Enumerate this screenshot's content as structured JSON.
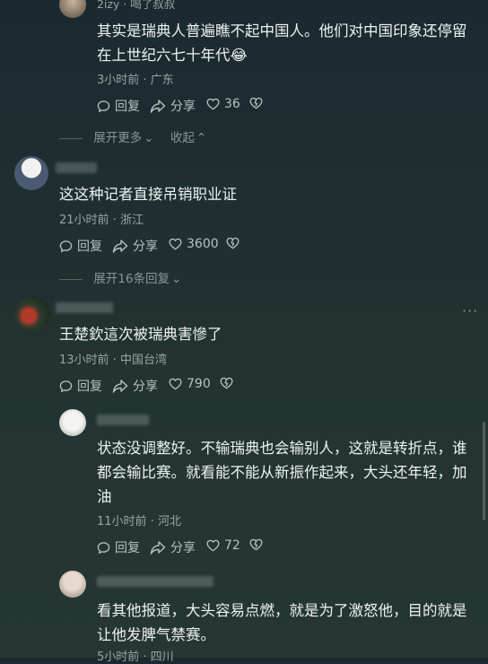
{
  "comments": [
    {
      "username": "2izy · 喝了叔叔",
      "text_lines": [
        "其实是瑞典人普遍瞧不起中国人。他们对中国印象还停留",
        "在上世纪六七十年代😂"
      ],
      "meta": "3小时前 · 广东",
      "reply_label": "回复",
      "share_label": "分享",
      "likes": "36"
    },
    {
      "username": "",
      "text_lines": [
        "这这种记者直接吊销职业证"
      ],
      "meta": "21小时前 · 浙江",
      "reply_label": "回复",
      "share_label": "分享",
      "likes": "3600"
    },
    {
      "username": "",
      "text_lines": [
        "王楚欽這次被瑞典害慘了"
      ],
      "meta": "13小时前 · 中国台湾",
      "reply_label": "回复",
      "share_label": "分享",
      "likes": "790"
    },
    {
      "username": "",
      "text_lines": [
        "状态没调整好。不输瑞典也会输别人，这就是转折点，谁",
        "都会输比赛。就看能不能从新振作起来，大头还年轻，加",
        "油"
      ],
      "meta": "11小时前 · 河北",
      "reply_label": "回复",
      "share_label": "分享",
      "likes": "72"
    },
    {
      "username": "",
      "text_lines": [
        "看其他报道，大头容易点燃，就是为了激怒他，目的就是",
        "让他发脾气禁赛。"
      ],
      "meta": "5小时前 · 四川"
    }
  ],
  "thread_controls": {
    "expand_more": "展开更多",
    "collapse": "收起",
    "expand_replies": "展开16条回复"
  },
  "icons": {
    "reply": "reply-bubble-icon",
    "share": "share-arrow-icon",
    "like": "heart-icon",
    "dislike": "broken-heart-icon",
    "more": "more-dots-icon"
  }
}
